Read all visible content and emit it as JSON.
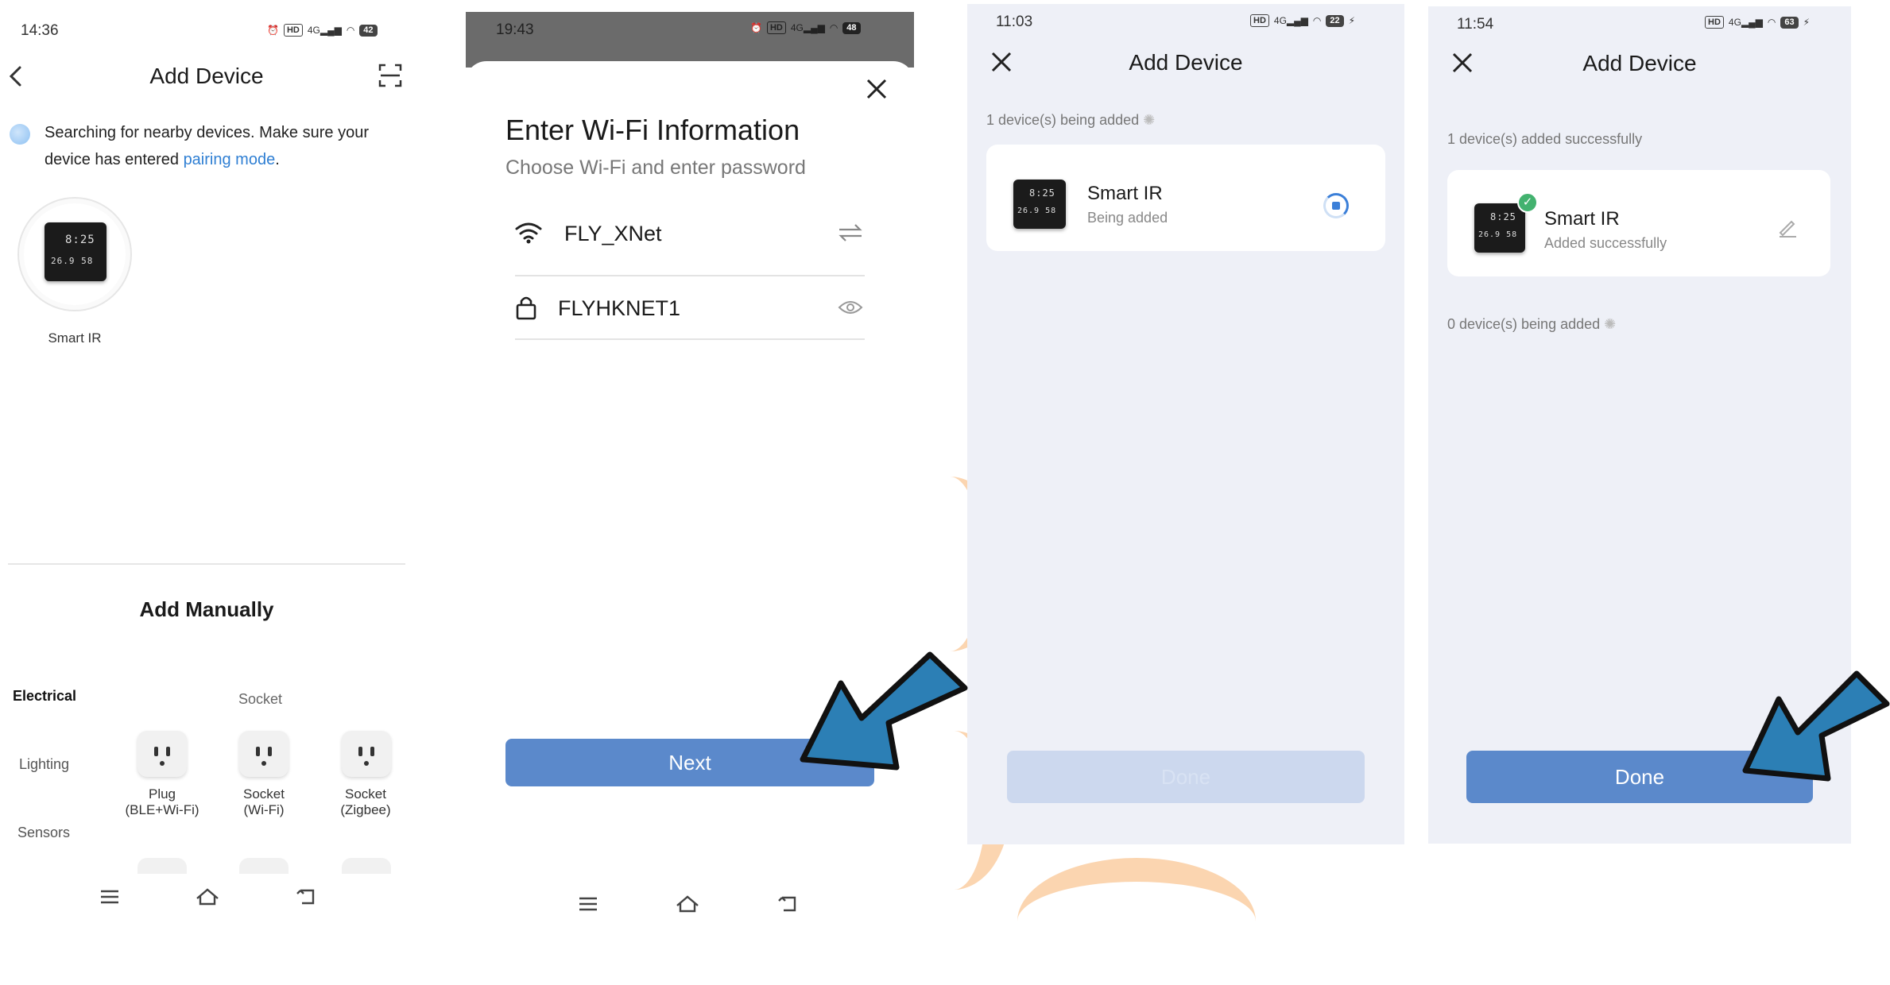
{
  "panel1": {
    "time": "14:36",
    "battery": "42",
    "title": "Add Device",
    "search_text": "Searching for nearby devices. Make sure your device has entered ",
    "search_link": "pairing mode",
    "search_end": ".",
    "found_device": {
      "name": "Smart IR",
      "lcd_top": "8:25",
      "lcd_bottom": "26.9 58"
    },
    "add_manually": "Add Manually",
    "categories": [
      "Electrical",
      "Lighting",
      "Sensors"
    ],
    "section_label": "Socket",
    "items": [
      {
        "label_line1": "Plug",
        "label_line2": "(BLE+Wi-Fi)"
      },
      {
        "label_line1": "Socket",
        "label_line2": "(Wi-Fi)"
      },
      {
        "label_line1": "Socket",
        "label_line2": "(Zigbee)"
      }
    ]
  },
  "panel2": {
    "time": "19:43",
    "battery": "48",
    "title": "Enter Wi-Fi Information",
    "subtitle": "Choose Wi-Fi and enter password",
    "ssid": "FLY_XNet",
    "password": "FLYHKNET1",
    "next_label": "Next"
  },
  "panel3": {
    "time": "11:03",
    "battery": "22",
    "title": "Add Device",
    "status": "1 device(s) being added",
    "device_name": "Smart IR",
    "device_state": "Being added",
    "done_label": "Done"
  },
  "panel4": {
    "time": "11:54",
    "battery": "63",
    "title": "Add Device",
    "status_success": "1 device(s) added successfully",
    "device_name": "Smart IR",
    "device_state": "Added successfully",
    "status_pending": "0 device(s) being added",
    "done_label": "Done"
  },
  "colors": {
    "accent": "#5b89cb",
    "link": "#2f7fd3",
    "disabled_button": "#ccd8ee",
    "panel_bg": "#eef0f7",
    "arrow": "#2c7fb5",
    "success": "#43b26f"
  }
}
